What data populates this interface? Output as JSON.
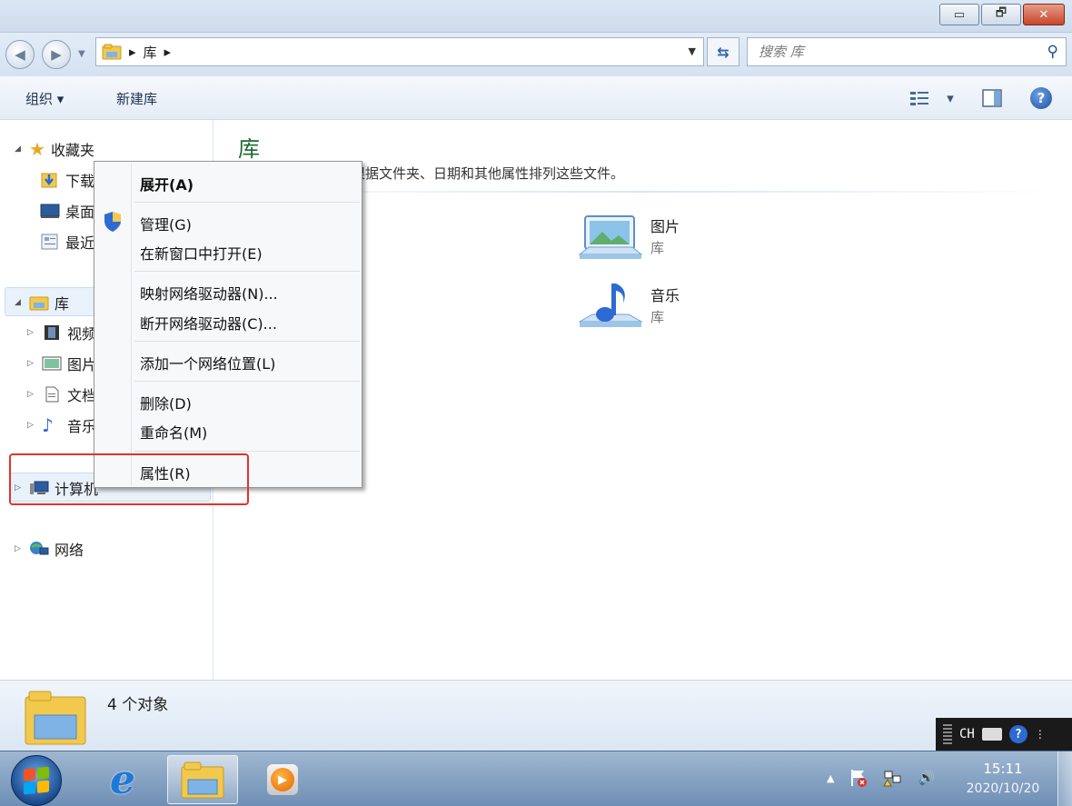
{
  "window": {
    "controls": {
      "minimize": "▭",
      "maximize": "🗗",
      "close": "✕"
    }
  },
  "address": {
    "separator": "▸",
    "path_item": "库",
    "search_placeholder": "搜索 库"
  },
  "toolbar": {
    "organize": "组织 ▾",
    "new_library": "新建库",
    "view_icon": "view-options-icon",
    "view_dropdown": "▾"
  },
  "nav": {
    "favorites": "收藏夹",
    "downloads": "下载",
    "desktop": "桌面",
    "recent": "最近",
    "libraries": "库",
    "videos": "视频",
    "pictures": "图片",
    "documents": "文档",
    "music": "音乐",
    "computer": "计算机",
    "network": "网络"
  },
  "content": {
    "title": "库",
    "description": "并根据文件夹、日期和其他属性排列这些文件。",
    "items": [
      {
        "name": "图片",
        "type": "库"
      },
      {
        "name": "音乐",
        "type": "库"
      }
    ]
  },
  "context_menu": {
    "expand": "展开(A)",
    "manage": "管理(G)",
    "open_new_window": "在新窗口中打开(E)",
    "map_drive": "映射网络驱动器(N)...",
    "disconnect_drive": "断开网络驱动器(C)...",
    "add_network_location": "添加一个网络位置(L)",
    "delete": "删除(D)",
    "rename": "重命名(M)",
    "properties": "属性(R)"
  },
  "details": {
    "count": "4 个对象"
  },
  "langbar": {
    "lang": "CH"
  },
  "taskbar": {
    "clock_time": "15:11",
    "clock_date": "2020/10/20",
    "tray_up": "▲",
    "volume": "🔊"
  },
  "colors": {
    "highlight_red": "#e4322b",
    "title_green": "#1e6a35",
    "selection_blue": "#e9f1fb"
  }
}
